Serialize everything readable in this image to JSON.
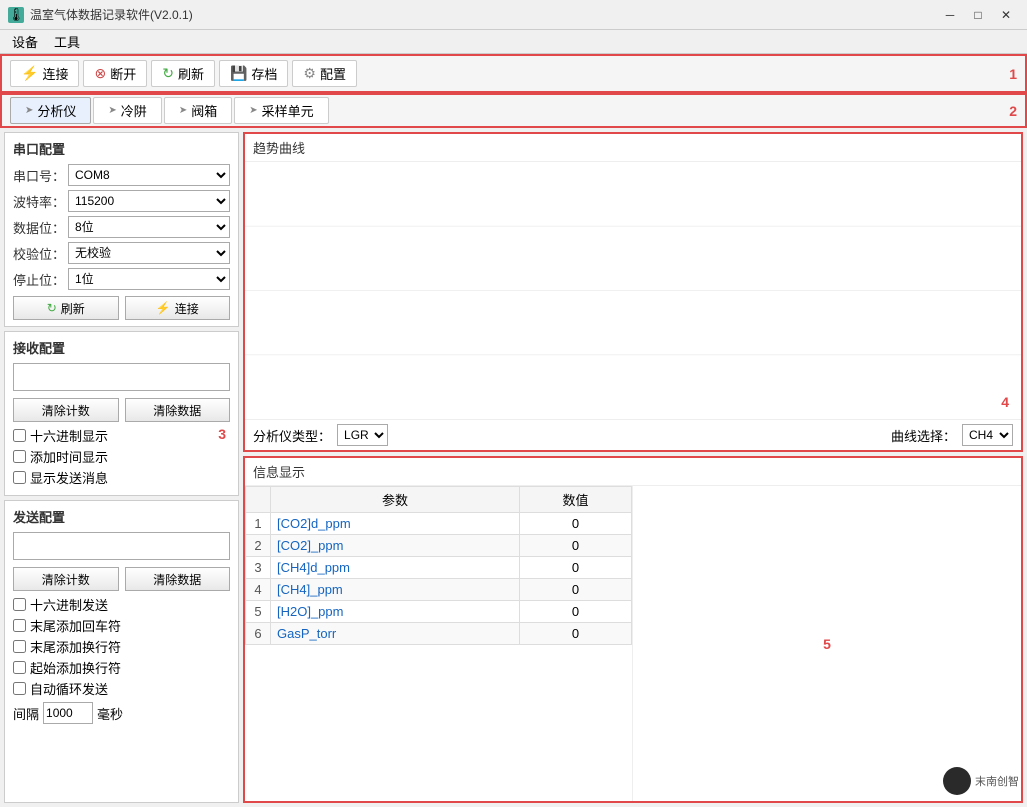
{
  "titlebar": {
    "icon": "🌡",
    "title": "温室气体数据记录软件(V2.0.1)",
    "min": "─",
    "max": "□",
    "close": "✕"
  },
  "menubar": {
    "items": [
      "设备",
      "工具"
    ]
  },
  "toolbar": {
    "label": "1",
    "buttons": [
      {
        "icon": "connect",
        "label": "连接"
      },
      {
        "icon": "disconnect",
        "label": "断开"
      },
      {
        "icon": "refresh",
        "label": "刷新"
      },
      {
        "icon": "save",
        "label": "存档"
      },
      {
        "icon": "config",
        "label": "配置"
      }
    ]
  },
  "tabs": {
    "label": "2",
    "items": [
      {
        "label": "分析仪",
        "active": true
      },
      {
        "label": "冷阱"
      },
      {
        "label": "阀箱"
      },
      {
        "label": "采样单元"
      }
    ]
  },
  "serial_config": {
    "title": "串口配置",
    "port_label": "串口号：",
    "port_value": "COM8",
    "baud_label": "波特率：",
    "baud_value": "115200",
    "data_label": "数据位：",
    "data_value": "8位",
    "check_label": "校验位：",
    "check_value": "无校验",
    "stop_label": "停止位：",
    "stop_value": "1位",
    "refresh_btn": "刷新",
    "connect_btn": "连接"
  },
  "recv_config": {
    "title": "接收配置",
    "clear_count_btn": "清除计数",
    "clear_data_btn": "清除数据",
    "checkboxes": [
      {
        "label": "十六进制显示",
        "checked": false
      },
      {
        "label": "添加时间显示",
        "checked": false
      },
      {
        "label": "显示发送消息",
        "checked": false
      }
    ],
    "label_num": "3"
  },
  "send_config": {
    "title": "发送配置",
    "clear_count_btn": "清除计数",
    "clear_data_btn": "清除数据",
    "checkboxes": [
      {
        "label": "十六进制发送",
        "checked": false
      },
      {
        "label": "末尾添加回车符",
        "checked": false
      },
      {
        "label": "末尾添加换行符",
        "checked": false
      },
      {
        "label": "起始添加换行符",
        "checked": false
      },
      {
        "label": "自动循环发送",
        "checked": false
      }
    ],
    "interval_label": "间隔",
    "interval_value": "1000",
    "interval_unit": "毫秒"
  },
  "trend": {
    "title": "趋势曲线",
    "label_num": "4",
    "analyzer_label": "分析仪类型：",
    "analyzer_value": "LGR",
    "curve_label": "曲线选择：",
    "curve_value": "CH4",
    "analyzer_options": [
      "LGR"
    ],
    "curve_options": [
      "CH4"
    ]
  },
  "info": {
    "title": "信息显示",
    "label_num": "5",
    "table": {
      "col1": "参数",
      "col2": "数值",
      "rows": [
        {
          "idx": "1",
          "param": "[CO2]d_ppm",
          "value": "0"
        },
        {
          "idx": "2",
          "param": "[CO2]_ppm",
          "value": "0"
        },
        {
          "idx": "3",
          "param": "[CH4]d_ppm",
          "value": "0"
        },
        {
          "idx": "4",
          "param": "[CH4]_ppm",
          "value": "0"
        },
        {
          "idx": "5",
          "param": "[H2O]_ppm",
          "value": "0"
        },
        {
          "idx": "6",
          "param": "GasP_torr",
          "value": "0"
        }
      ]
    }
  },
  "watermark": "末南创智"
}
